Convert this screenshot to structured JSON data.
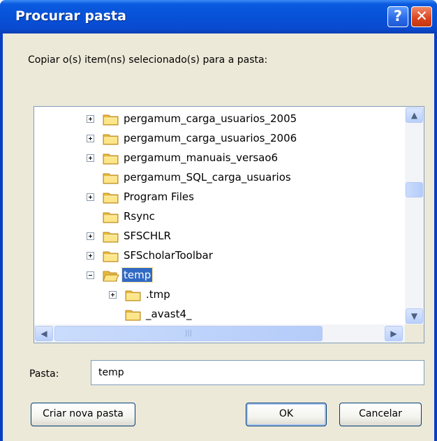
{
  "window": {
    "title": "Procurar pasta"
  },
  "title_buttons": {
    "help": "?",
    "close": "✕"
  },
  "instruction": "Copiar o(s) item(ns) selecionado(s) para a pasta:",
  "tree": {
    "items": [
      {
        "label": "pergamum_carga_usuarios_2005",
        "expander": "plus",
        "selected": false
      },
      {
        "label": "pergamum_carga_usuarios_2006",
        "expander": "plus",
        "selected": false
      },
      {
        "label": "pergamum_manuais_versao6",
        "expander": "plus",
        "selected": false
      },
      {
        "label": "pergamum_SQL_carga_usuarios",
        "expander": "none",
        "selected": false
      },
      {
        "label": "Program Files",
        "expander": "plus",
        "selected": false
      },
      {
        "label": "Rsync",
        "expander": "none",
        "selected": false
      },
      {
        "label": "SFSCHLR",
        "expander": "plus",
        "selected": false
      },
      {
        "label": "SFScholarToolbar",
        "expander": "plus",
        "selected": false
      },
      {
        "label": "temp",
        "expander": "minus",
        "selected": true,
        "open": true
      },
      {
        "label": ".tmp",
        "expander": "plus",
        "selected": false
      },
      {
        "label": "_avast4_",
        "expander": "none",
        "selected": false
      }
    ]
  },
  "scrollbars": {
    "up": "▲",
    "down": "▼",
    "left": "◀",
    "right": "▶",
    "grip": "|||"
  },
  "folder_field": {
    "label": "Pasta:",
    "value": "temp"
  },
  "buttons": {
    "new_folder": "Criar nova pasta",
    "ok": "OK",
    "cancel": "Cancelar"
  },
  "colors": {
    "title_bar": "#0a5ae0",
    "dialog_bg": "#ece9d8",
    "selection": "#316ac5",
    "close": "#d9431f"
  }
}
